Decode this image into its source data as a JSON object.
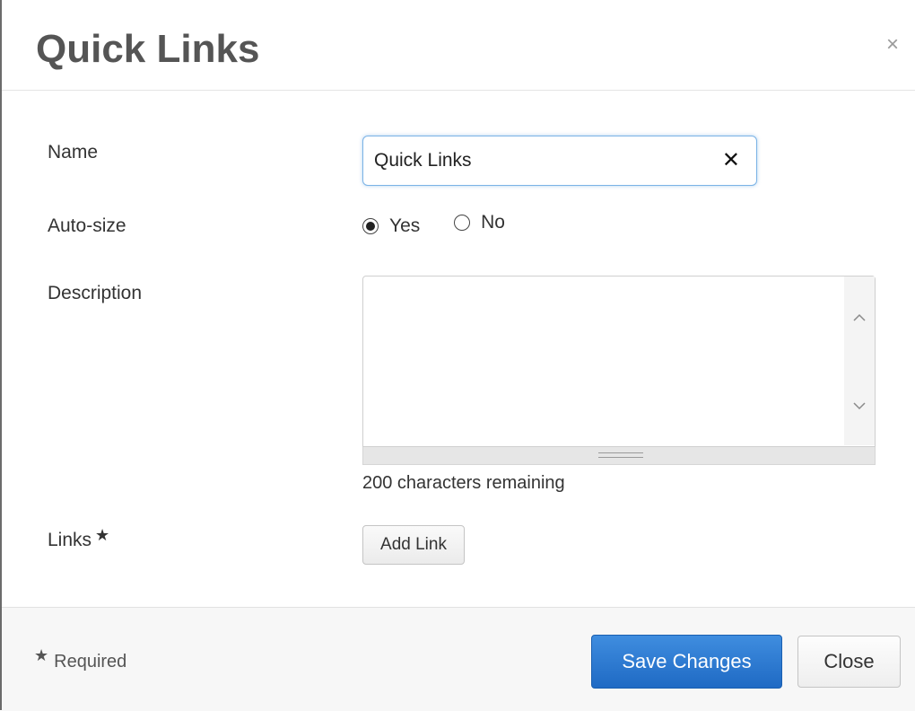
{
  "dialog": {
    "title": "Quick Links",
    "close_glyph": "×"
  },
  "form": {
    "name": {
      "label": "Name",
      "value": "Quick Links",
      "clear_glyph": "✕"
    },
    "autosize": {
      "label": "Auto-size",
      "options": [
        {
          "label": "Yes",
          "selected": true
        },
        {
          "label": "No",
          "selected": false
        }
      ]
    },
    "description": {
      "label": "Description",
      "value": "",
      "remaining_text": "200 characters remaining"
    },
    "links": {
      "label": "Links",
      "required_glyph": "★",
      "add_button_label": "Add Link"
    }
  },
  "footer": {
    "required_glyph": "★",
    "required_text": "Required",
    "save_label": "Save Changes",
    "close_label": "Close"
  },
  "colors": {
    "primary_button": "#1f6ac4",
    "focus_border": "#7bb3e6",
    "title_text": "#555555"
  },
  "icons": [
    "close-icon",
    "clear-input-icon",
    "scroll-up-icon",
    "scroll-down-icon",
    "resize-grip-icon",
    "required-star-icon"
  ]
}
